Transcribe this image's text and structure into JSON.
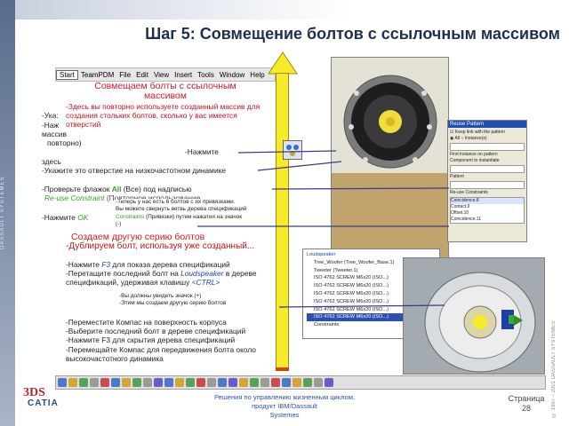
{
  "branding": {
    "left_bar_text": "DASSAULT SYSTEMES",
    "logo_mark": "3DS",
    "logo_name": "CATIA",
    "right_note": "© 1997 – 2001 DASSAULT SYSTEMES"
  },
  "title": "Шаг 5: Совмещение болтов с ссылочным массивом",
  "menu": [
    "Start",
    "TeamPDM",
    "File",
    "Edit",
    "View",
    "Insert",
    "Tools",
    "Window",
    "Help"
  ],
  "section1": {
    "heading": "Совмещаем болты с ссылочным массивом",
    "note": "-Здесь вы повторно используете созданный массив для создания стольких болтов, сколько у вас имеется отверстий",
    "partial_lines": [
      "-Ука:",
      "-Наж",
      "массив",
      "повторно)"
    ],
    "press": "-Нажмите",
    "here": "здесь",
    "point_hole": "-Укажите это отверстие на низкочастотном динамике",
    "check_flag_prefix": "-Проверьте флажок",
    "check_flag_value": "All",
    "check_flag_suffix": "(Все) под надписью",
    "reuse_label": "Re-use Constraint",
    "reuse_suffix": "(Повторное использование",
    "press_ok_prefix": "-Нажмите",
    "press_ok_value": "OK",
    "callout_line1": "-Теперь у нас есть 6 болтов с их привязками.",
    "callout_line2": "Вы можете свернуть ветвь дерева спецификаций",
    "callout_constraints": "Constraints",
    "callout_line3": "(Привязки) путем нажатия на значок",
    "callout_symbol": "(-)"
  },
  "section2": {
    "heading": "Создаем другую серию болтов",
    "line1": "-Дублируем болт, используя уже созданный...",
    "line2_prefix": "-Нажмите",
    "line2_key": "F3",
    "line2_suffix": "для показа дерева спецификаций",
    "line3_prefix": "-Перетащите последний болт на",
    "line3_target": "Loudspeaker",
    "line3_suffix": "в дереве спецификаций, удерживая клавишу",
    "line3_key": "<CTRL>",
    "note1": "-Вы должны увидеть значок (+)",
    "note2": "-Этим мы создаем другую серию болтов",
    "steps": [
      "-Переместите Компас на поверхность корпуса",
      "-Выберите последний болт в дереве спецификаций",
      "-Нажмите F3 для скрытия дерева спецификаций",
      "-Перемещайте Компас для передвижения болта около высокочастотного динамика"
    ]
  },
  "dialog": {
    "title": "Reuse Pattern",
    "options": [
      "Keep link with the pattern",
      "All",
      "Instance(s)",
      "First instance on pattern",
      "Component to instantiate",
      "Pattern",
      "Re-use Constraints"
    ],
    "rows": [
      "Coincidence.8",
      "Contact.9",
      "Offset.10",
      "Coincidence.11"
    ]
  },
  "tree": {
    "items": [
      "Loudspeaker",
      "Tree_Woofer (Tree_Woofer_Base.1)",
      "Tweeter (Tweeter.1)",
      "ISO 4762 SCREW M6x20 (ISO...)",
      "ISO 4762 SCREW M6x20 (ISO...)",
      "ISO 4762 SCREW M6x20 (ISO...)",
      "ISO 4762 SCREW M6x20 (ISO...)",
      "ISO 4762 SCREW M6x20 (ISO...)",
      "ISO 4762 SCREW M6x20 (ISO...)",
      "Constraints"
    ]
  },
  "footer": {
    "line1": "Решения по управлению жизненным циклом, продукт IBM/Dassault",
    "line2": "Systemes",
    "page_label": "Страница",
    "page_number": "28"
  },
  "colors": {
    "heading_red": "#d41a24",
    "arrow_yellow": "#f6ea2a",
    "title_navy": "#1f2f4f",
    "link_blue": "#2a53a6"
  }
}
